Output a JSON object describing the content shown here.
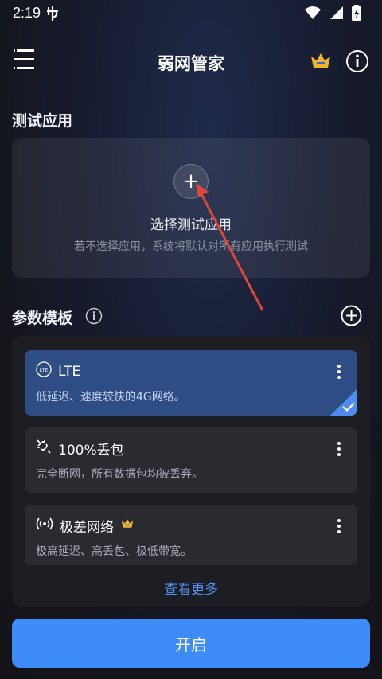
{
  "status_bar": {
    "time": "2:19"
  },
  "header": {
    "title": "弱网管家"
  },
  "test_app": {
    "section_title": "测试应用",
    "select_label": "选择测试应用",
    "hint": "若不选择应用，系统将默认对所有应用执行测试"
  },
  "templates": {
    "section_title": "参数模板",
    "items": [
      {
        "name": "LTE",
        "desc": "低延迟、速度较快的4G网络。",
        "icon": "lte-icon",
        "selected": true
      },
      {
        "name": "100%丢包",
        "desc": "完全断网，所有数据包均被丢弃。",
        "icon": "broken-link-icon"
      },
      {
        "name": "极差网络",
        "desc": "极高延迟、高丢包、极低带宽。",
        "icon": "broadcast-icon",
        "premium": true
      }
    ],
    "view_more": "查看更多"
  },
  "start_button": "开启",
  "colors": {
    "accent": "#3e8cf7",
    "selected_item": "#2f4d85",
    "crown": "#f0b429",
    "arrow": "#e0473a"
  }
}
